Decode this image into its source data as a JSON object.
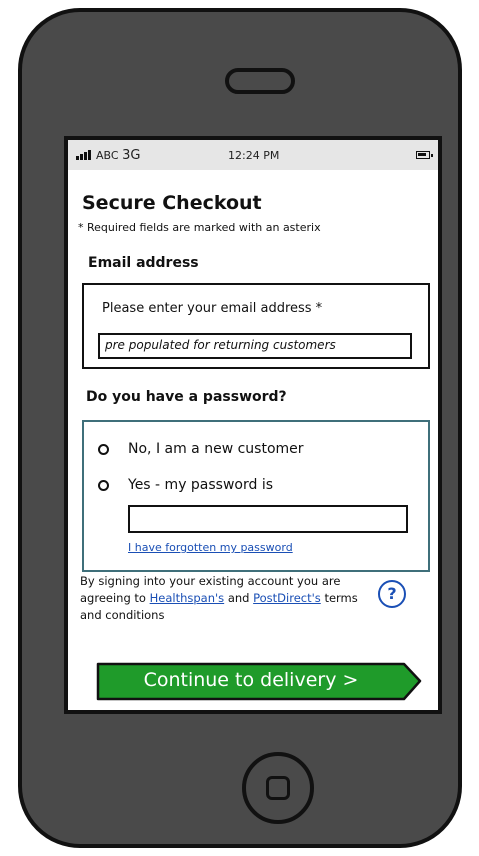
{
  "status_bar": {
    "carrier": "ABC",
    "network": "3G",
    "time": "12:24 PM"
  },
  "page": {
    "title": "Secure Checkout",
    "required_note": "* Required fields are marked with an asterix"
  },
  "email_section": {
    "heading": "Email address",
    "label": "Please enter your email address *",
    "value": "pre populated for returning customers"
  },
  "password_section": {
    "heading": "Do you have a password?",
    "option_new": "No, I am a new customer",
    "option_existing": "Yes - my password is",
    "password_value": "",
    "forgot_link": "I have forgotten my password"
  },
  "terms": {
    "prefix": "By signing into your existing account you are agreeing to",
    "link1": "Healthspan's",
    "middle": "and",
    "link2": "PostDirect's",
    "suffix": "terms and conditions"
  },
  "help_icon": "?",
  "cta": {
    "label": "Continue to delivery >",
    "color": "#1f9b2a"
  },
  "colors": {
    "phone_body": "#4a4a4a",
    "status_bar": "#e6e6e6",
    "password_box_border": "#3f6f7a",
    "link": "#1a4fb5"
  }
}
